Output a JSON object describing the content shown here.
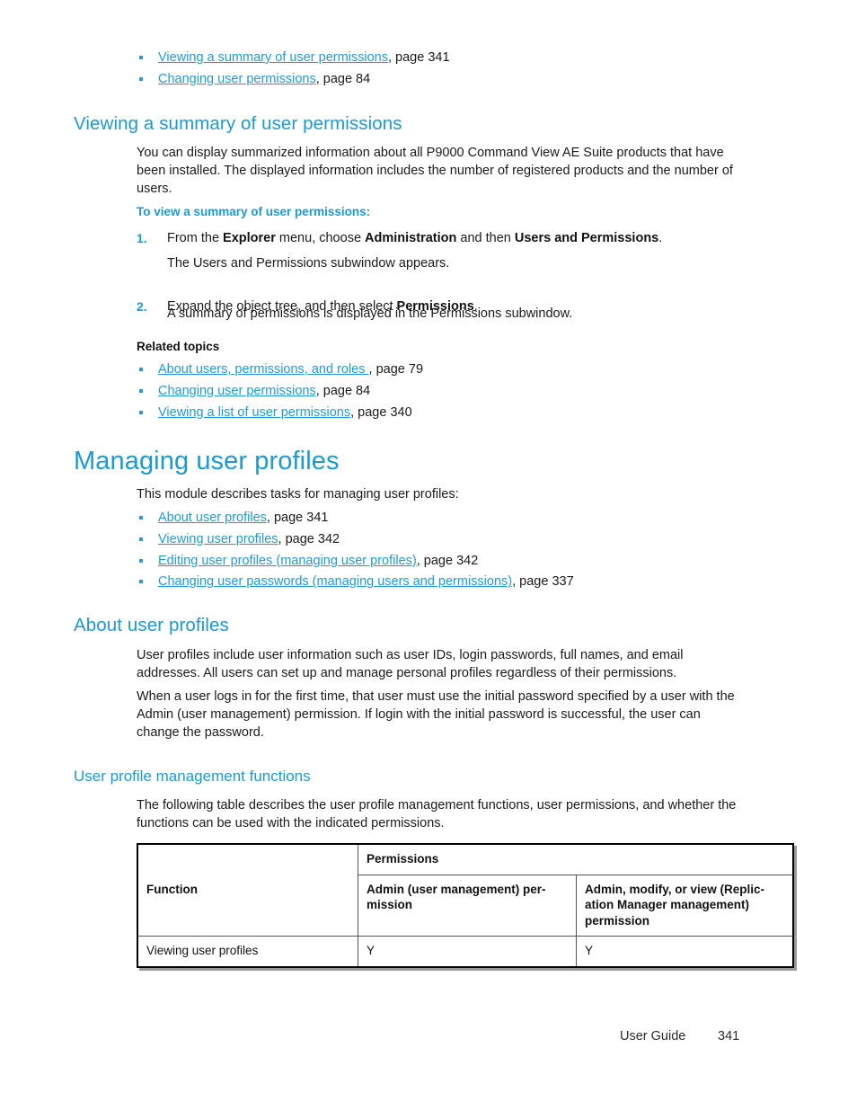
{
  "top_links": [
    {
      "text": "Viewing a summary of user permissions",
      "suffix": ", page 341"
    },
    {
      "text": "Changing user permissions",
      "suffix": ", page 84"
    }
  ],
  "section_viewing_summary": {
    "heading": "Viewing a summary of user permissions",
    "intro": "You can display summarized information about all P9000 Command View AE Suite products that have been installed. The displayed information includes the number of registered products and the number of users.",
    "procedure_heading": "To view a summary of user permissions:",
    "steps": [
      {
        "number": "1.",
        "pre": "From the ",
        "bold1": "Explorer",
        "mid1": " menu, choose ",
        "bold2": "Administration",
        "mid2": " and then ",
        "bold3": "Users and Permissions",
        "post": ".",
        "result": "The Users and Permissions subwindow appears."
      },
      {
        "number": "2.",
        "pre": "Expand the object tree, and then select ",
        "bold1": "Permissions",
        "mid1": "",
        "bold2": "",
        "mid2": "",
        "bold3": "",
        "post": ".",
        "result": "A summary of permissions is displayed in the Permissions subwindow."
      }
    ],
    "related_heading": "Related topics",
    "related_links": [
      {
        "text": "About users, permissions, and roles ",
        "suffix": ", page 79"
      },
      {
        "text": "Changing user permissions",
        "suffix": ", page 84"
      },
      {
        "text": "Viewing a list of user permissions",
        "suffix": ", page 340"
      }
    ]
  },
  "section_managing_profiles": {
    "heading": "Managing user profiles",
    "intro": "This module describes tasks for managing user profiles:",
    "links": [
      {
        "text": "About user profiles",
        "suffix": ", page 341"
      },
      {
        "text": "Viewing user profiles",
        "suffix": ", page 342"
      },
      {
        "text": "Editing user profiles (managing user profiles)",
        "suffix": ", page 342"
      },
      {
        "text": "Changing user passwords (managing users and permissions)",
        "suffix": ", page 337"
      }
    ]
  },
  "section_about_profiles": {
    "heading": "About user profiles",
    "para1": "User profiles include user information such as user IDs, login passwords, full names, and email addresses. All users can set up and manage personal profiles regardless of their permissions.",
    "para2": "When a user logs in for the first time, that user must use the initial password specified by a user with the Admin (user management) permission. If login with the initial password is successful, the user can change the password."
  },
  "section_management_functions": {
    "heading": "User profile management functions",
    "intro": "The following table describes the user profile management functions, user permissions, and whether the functions can be used with the indicated permissions.",
    "table": {
      "group_header": "Permissions",
      "col_function": "Function",
      "col_admin": "Admin (user management) per-mission",
      "col_other": "Admin, modify, or view (Replic-ation Manager management) permission",
      "rows": [
        {
          "function": "Viewing user profiles",
          "admin": "Y",
          "other": "Y"
        }
      ]
    }
  },
  "footer": {
    "label": "User Guide",
    "page_number": "341"
  },
  "colors": {
    "link": "#1f9bd8",
    "heading": "#1b9ad6",
    "text": "#1a1a1a"
  }
}
